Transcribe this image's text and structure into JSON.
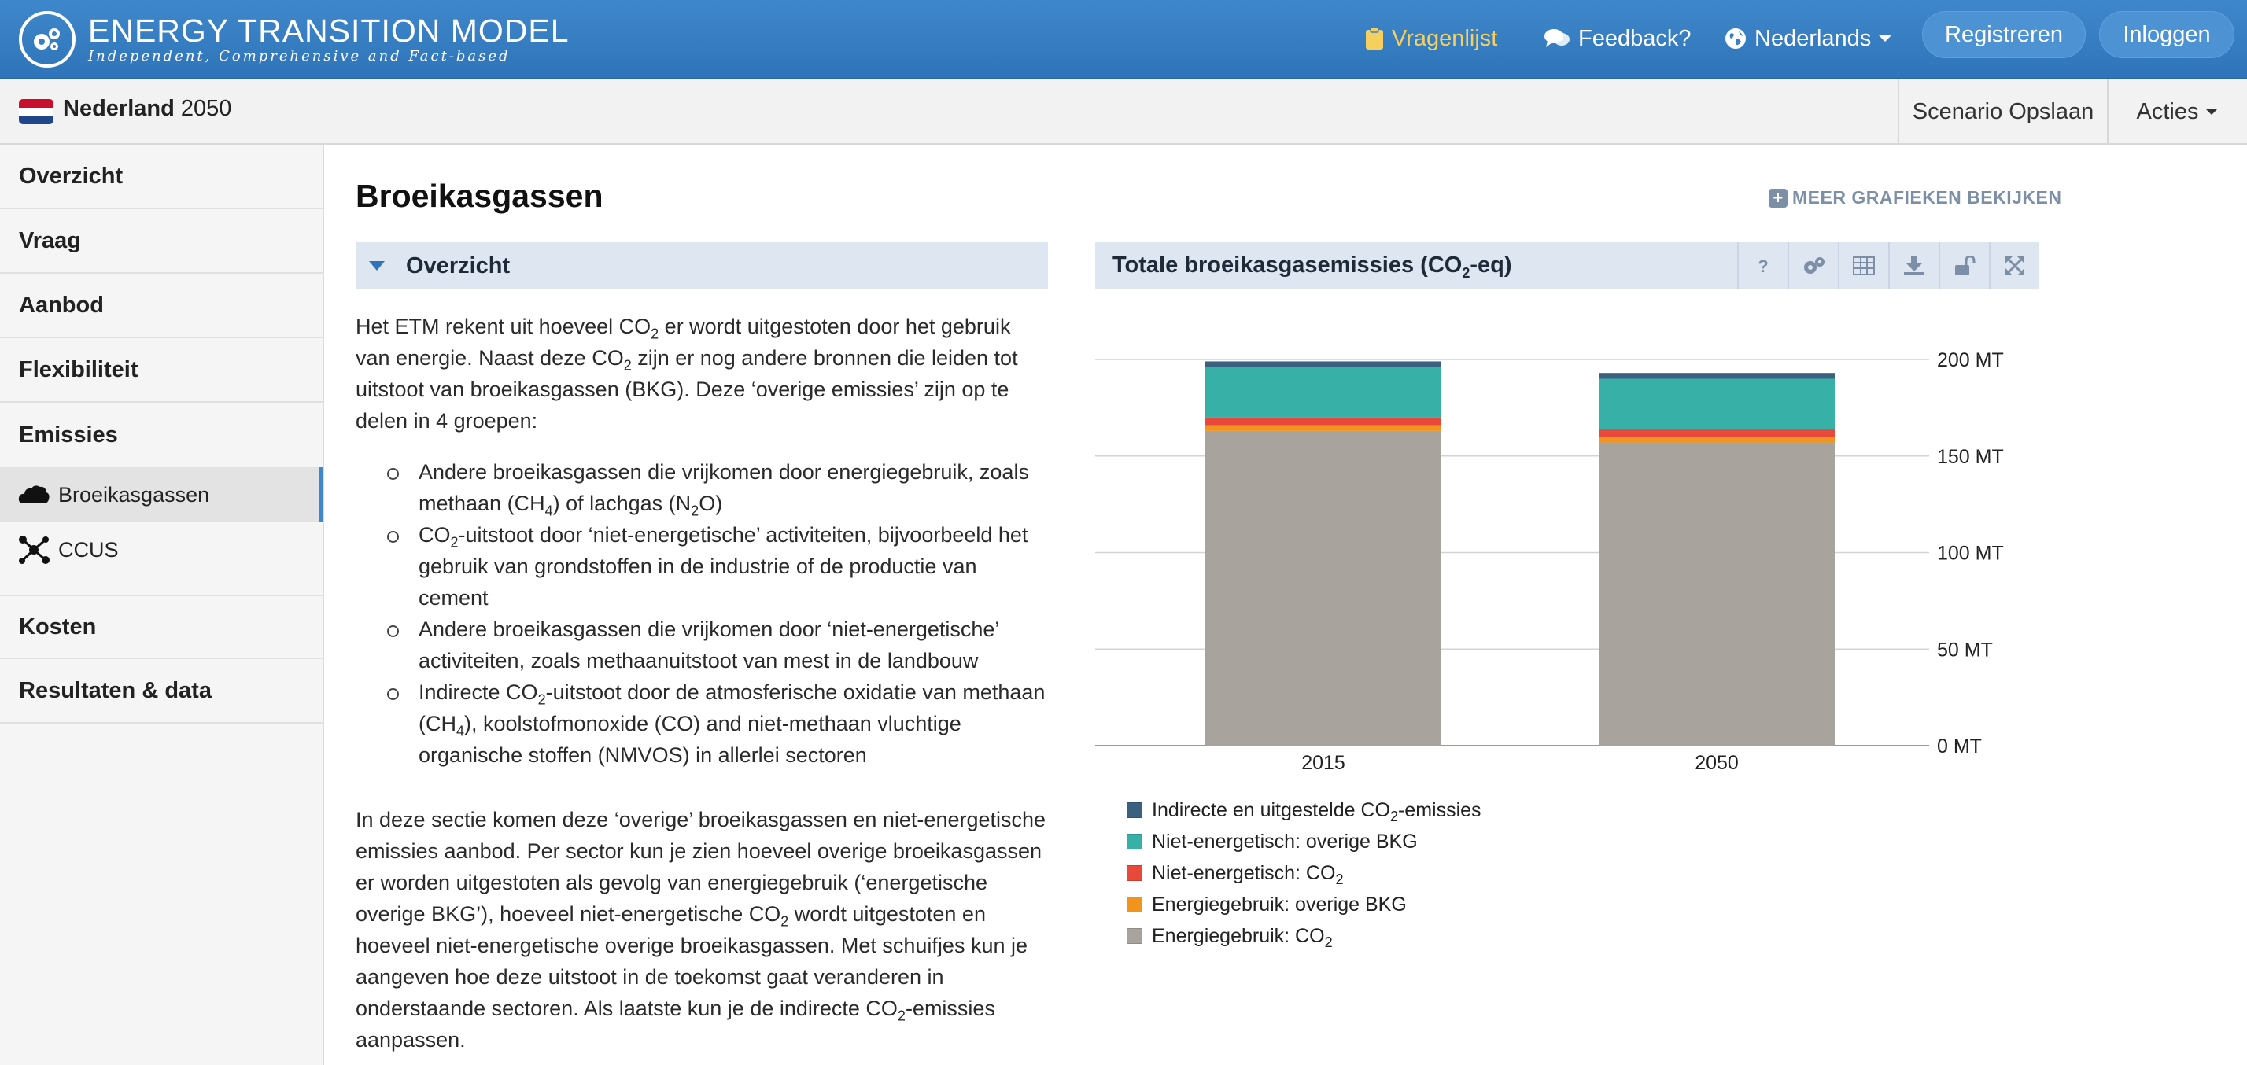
{
  "header": {
    "logo_title": "ENERGY TRANSITION MODEL",
    "logo_subtitle": "Independent, Comprehensive and Fact-based",
    "nav_vragenlijst": "Vragenlijst",
    "nav_feedback": "Feedback?",
    "nav_language": "Nederlands",
    "register_label": "Registreren",
    "login_label": "Inloggen"
  },
  "subheader": {
    "country": "Nederland",
    "year": "2050",
    "save_label": "Scenario Opslaan",
    "actions_label": "Acties"
  },
  "sidebar": {
    "items": [
      {
        "label": "Overzicht"
      },
      {
        "label": "Vraag"
      },
      {
        "label": "Aanbod"
      },
      {
        "label": "Flexibiliteit"
      },
      {
        "label": "Emissies"
      }
    ],
    "subitems": [
      {
        "label": "Broeikasgassen",
        "active": true
      },
      {
        "label": "CCUS",
        "active": false
      }
    ],
    "bottom_items": [
      {
        "label": "Kosten"
      },
      {
        "label": "Resultaten & data"
      }
    ]
  },
  "main": {
    "page_title": "Broeikasgassen",
    "more_charts": "MEER GRAFIEKEN BEKIJKEN",
    "section_title": "Overzicht",
    "intro_parts": [
      "Het ETM rekent uit hoeveel CO",
      "2",
      " er wordt uitgestoten door het gebruik van energie. Naast deze CO",
      "2",
      " zijn er nog andere bronnen die leiden tot uitstoot van broeikasgassen (BKG). Deze ‘overige emissies’ zijn op te delen in 4 groepen:"
    ],
    "bullets": [
      [
        "Andere broeikasgassen die vrijkomen door energiegebruik, zoals methaan (CH",
        "4",
        ") of lachgas (N",
        "2",
        "O)"
      ],
      [
        "CO",
        "2",
        "-uitstoot door ‘niet-energetische’ activiteiten, bijvoorbeeld het gebruik van grondstoffen in de industrie of de productie van cement"
      ],
      [
        "Andere broeikasgassen die vrijkomen door ‘niet-energetische’ activiteiten, zoals methaanuitstoot van mest in de landbouw"
      ],
      [
        "Indirecte CO",
        "2",
        "-uitstoot door de atmosferische oxidatie van methaan (CH",
        "4",
        "), koolstofmonoxide (CO) and niet-methaan vluchtige organische stoffen (NMVOS) in allerlei sectoren"
      ]
    ],
    "closing_parts": [
      "In deze sectie komen deze ‘overige’ broeikasgassen en niet-energetische emissies aanbod. Per sector kun je zien hoeveel overige broeikasgassen er worden uitgestoten als gevolg van energiegebruik (‘energetische overige BKG’), hoeveel niet-energetische CO",
      "2",
      " wordt uitgestoten en hoeveel niet-energetische overige broeikasgassen. Met schuifjes kun je aangeven hoe deze uitstoot in de toekomst gaat veranderen in onderstaande sectoren. Als laatste kun je de indirecte CO",
      "2",
      "-emissies aanpassen."
    ]
  },
  "chart_toolbar": [
    "help-icon",
    "settings-icon",
    "table-icon",
    "download-icon",
    "unlock-icon",
    "fullscreen-icon"
  ],
  "chart_data": {
    "type": "bar",
    "stacked": true,
    "title_parts": [
      "Totale broeikasgasemissies (CO",
      "2",
      "-eq)"
    ],
    "categories": [
      "2015",
      "2050"
    ],
    "unit": "MT",
    "ylim": [
      0,
      200
    ],
    "yticks": [
      0,
      50,
      100,
      150,
      200
    ],
    "ytick_labels": [
      "0 MT",
      "50 MT",
      "100 MT",
      "150 MT",
      "200 MT"
    ],
    "grid": true,
    "series": [
      {
        "name_parts": [
          "Energiegebruik: CO",
          "2",
          ""
        ],
        "color": "#a8a39c",
        "values": [
          163,
          157
        ]
      },
      {
        "name_parts": [
          "Energiegebruik: overige BKG",
          "",
          ""
        ],
        "color": "#f0941e",
        "values": [
          3,
          3
        ]
      },
      {
        "name_parts": [
          "Niet-energetisch: CO",
          "2",
          ""
        ],
        "color": "#e8493a",
        "values": [
          4,
          4
        ]
      },
      {
        "name_parts": [
          "Niet-energetisch: overige BKG",
          "",
          ""
        ],
        "color": "#37b0a8",
        "values": [
          26,
          26
        ]
      },
      {
        "name_parts": [
          "Indirecte en uitgestelde CO",
          "2",
          "-emissies"
        ],
        "color": "#3a6280",
        "values": [
          3,
          3
        ]
      }
    ],
    "legend_order": [
      4,
      3,
      2,
      1,
      0
    ]
  }
}
